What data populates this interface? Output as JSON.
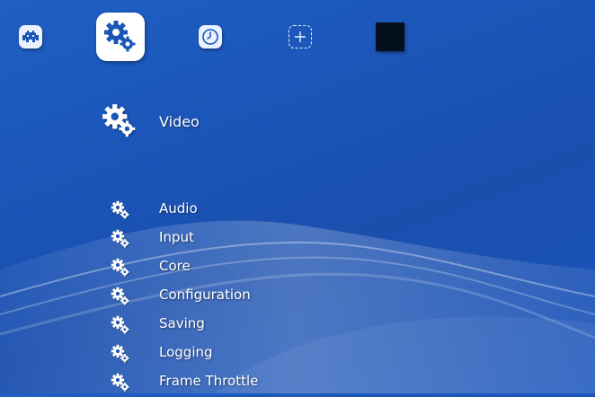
{
  "colors": {
    "background": "#1b55b8",
    "text": "#ffffff",
    "tile": "#eaf1ff"
  },
  "tabs": [
    {
      "name": "main-menu",
      "icon": "retroarch-invader-icon"
    },
    {
      "name": "settings",
      "icon": "gears-icon",
      "active": true
    },
    {
      "name": "history",
      "icon": "clock-icon"
    },
    {
      "name": "add",
      "icon": "add-content-icon"
    },
    {
      "name": "thumbnail",
      "icon": "black-thumbnail-icon"
    }
  ],
  "selected": {
    "label": "Video",
    "icon": "gears-icon"
  },
  "menu_items": [
    {
      "label": "Audio",
      "icon": "gears-icon"
    },
    {
      "label": "Input",
      "icon": "gears-icon"
    },
    {
      "label": "Core",
      "icon": "gears-icon"
    },
    {
      "label": "Configuration",
      "icon": "gears-icon"
    },
    {
      "label": "Saving",
      "icon": "gears-icon"
    },
    {
      "label": "Logging",
      "icon": "gears-icon"
    },
    {
      "label": "Frame Throttle",
      "icon": "gears-icon"
    }
  ]
}
